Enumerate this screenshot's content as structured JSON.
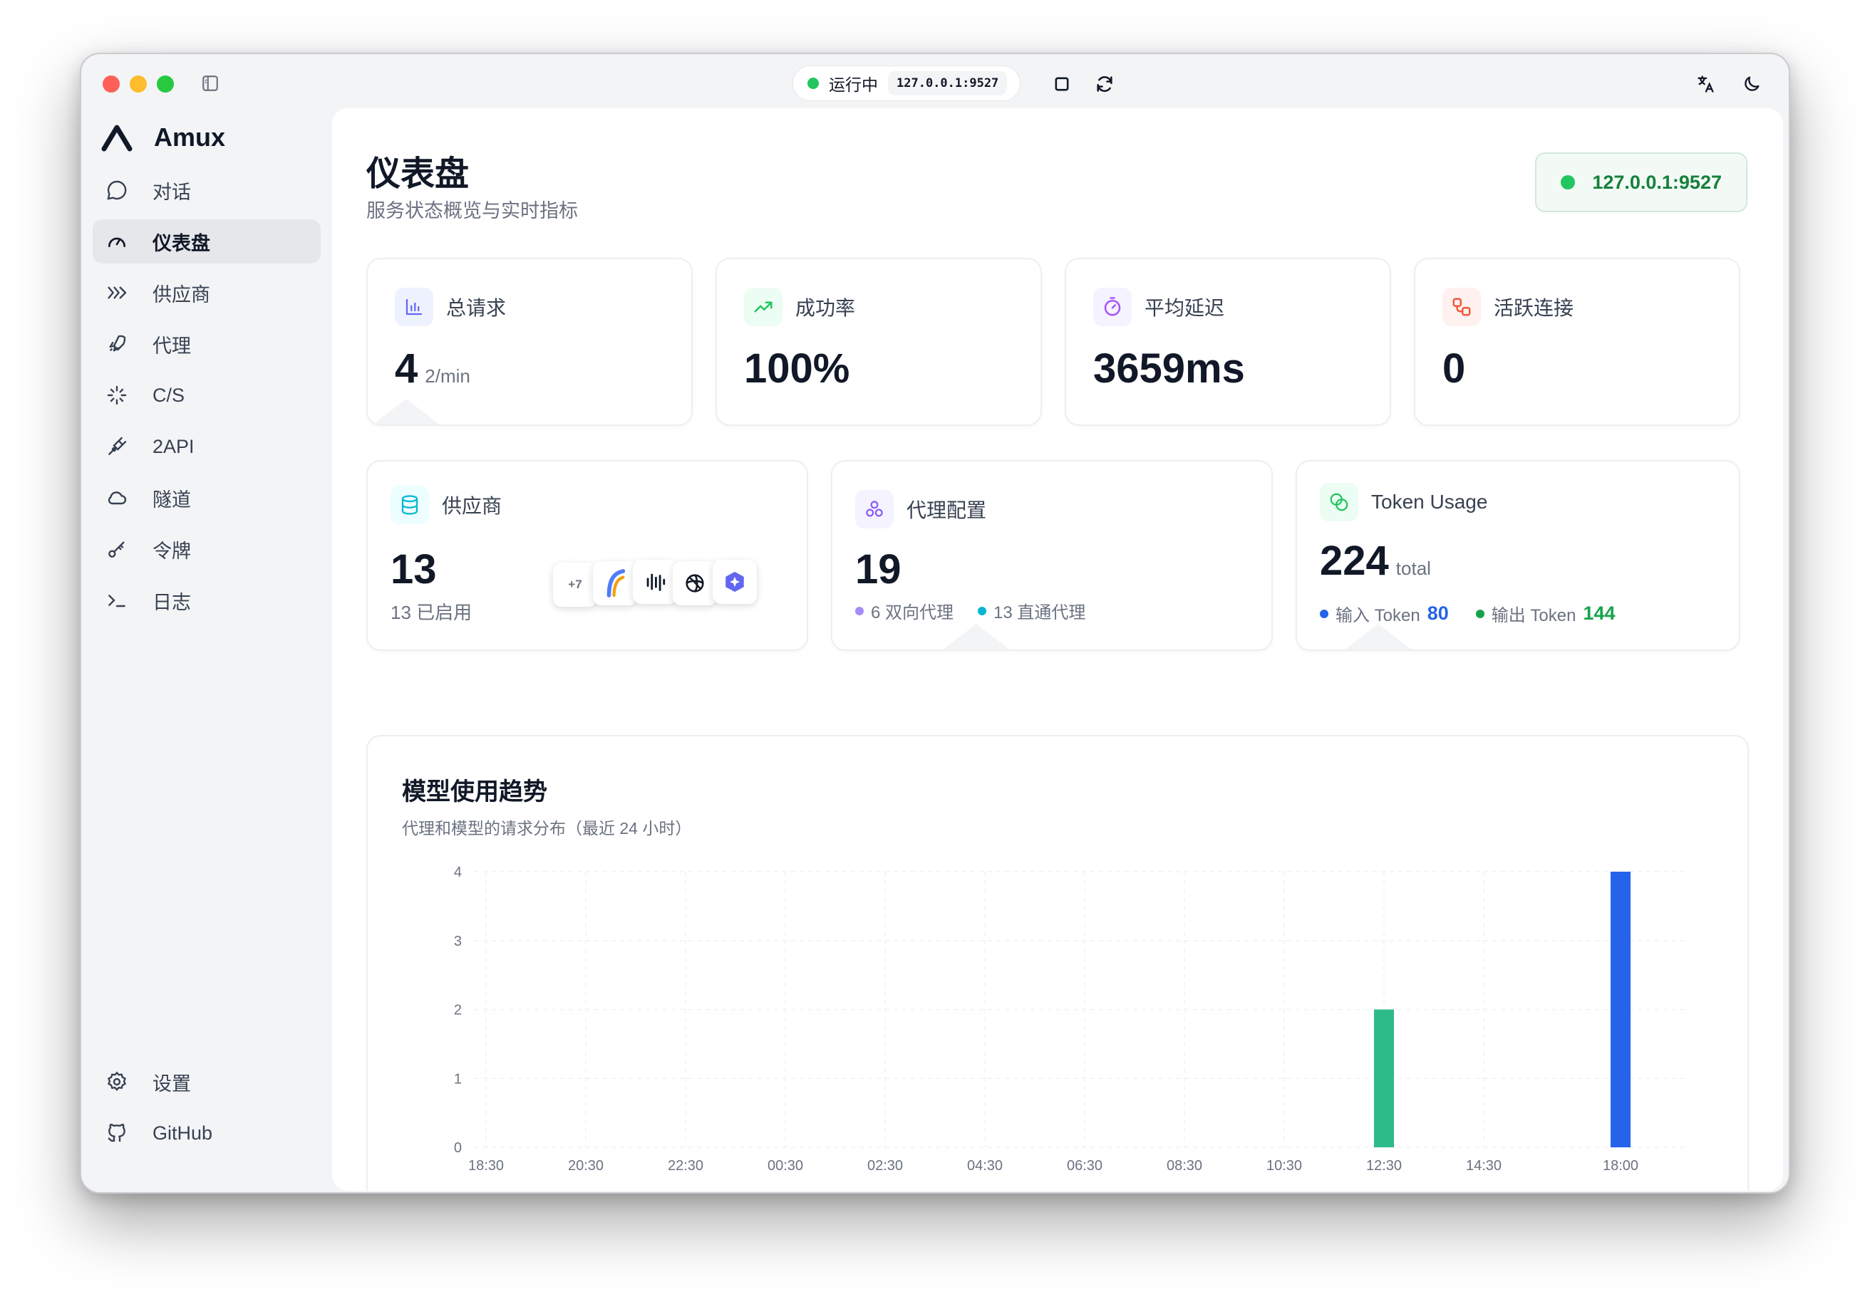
{
  "titlebar": {
    "status_text": "运行中",
    "address": "127.0.0.1:9527"
  },
  "brand": {
    "name": "Amux"
  },
  "sidebar": {
    "items": [
      {
        "label": "对话",
        "icon": "chat-bubble-icon"
      },
      {
        "label": "仪表盘",
        "icon": "gauge-icon",
        "active": true
      },
      {
        "label": "供应商",
        "icon": "provider-chevrons-icon"
      },
      {
        "label": "代理",
        "icon": "rocket-icon"
      },
      {
        "label": "C/S",
        "icon": "client-server-icon"
      },
      {
        "label": "2API",
        "icon": "plug-icon"
      },
      {
        "label": "隧道",
        "icon": "cloud-icon"
      },
      {
        "label": "令牌",
        "icon": "key-icon"
      },
      {
        "label": "日志",
        "icon": "terminal-icon"
      }
    ],
    "bottom": [
      {
        "label": "设置",
        "icon": "gear-icon"
      },
      {
        "label": "GitHub",
        "icon": "github-icon"
      }
    ]
  },
  "header": {
    "title": "仪表盘",
    "subtitle": "服务状态概览与实时指标",
    "server_badge": "127.0.0.1:9527"
  },
  "stats": {
    "total_requests": {
      "label": "总请求",
      "value": "4",
      "unit": "2/min"
    },
    "success_rate": {
      "label": "成功率",
      "value": "100%"
    },
    "avg_latency": {
      "label": "平均延迟",
      "value": "3659ms"
    },
    "active_connections": {
      "label": "活跃连接",
      "value": "0"
    }
  },
  "providers_card": {
    "label": "供应商",
    "value": "13",
    "sub": "13 已启用",
    "more_badge": "+7"
  },
  "proxy_card": {
    "label": "代理配置",
    "value": "19",
    "bidirectional": "6 双向代理",
    "direct": "13 直通代理"
  },
  "token_card": {
    "label": "Token Usage",
    "value": "224",
    "unit": "total",
    "input_label": "输入 Token",
    "input_value": "80",
    "output_label": "输出 Token",
    "output_value": "144"
  },
  "colors": {
    "green": "#22c55e",
    "teal_bar": "#2dbb8a",
    "blue_bar": "#2563eb",
    "input_blue": "#2563eb",
    "output_green": "#16a34a",
    "purple": "#a78bfa",
    "cyan": "#06b6d4"
  },
  "chart": {
    "title": "模型使用趋势",
    "subtitle": "代理和模型的请求分布（最近 24 小时）"
  },
  "chart_data": {
    "type": "bar",
    "categories": [
      "18:30",
      "20:30",
      "22:30",
      "00:30",
      "02:30",
      "04:30",
      "06:30",
      "08:30",
      "10:30",
      "12:30",
      "14:30",
      "18:00"
    ],
    "values": [
      0,
      0,
      0,
      0,
      0,
      0,
      0,
      0,
      0,
      2,
      0,
      4
    ],
    "bar_colors": [
      "#2dbb8a",
      "#2563eb"
    ],
    "yticks": [
      "0",
      "1",
      "2",
      "3",
      "4"
    ],
    "ylim": [
      0,
      4
    ],
    "grid": true
  }
}
